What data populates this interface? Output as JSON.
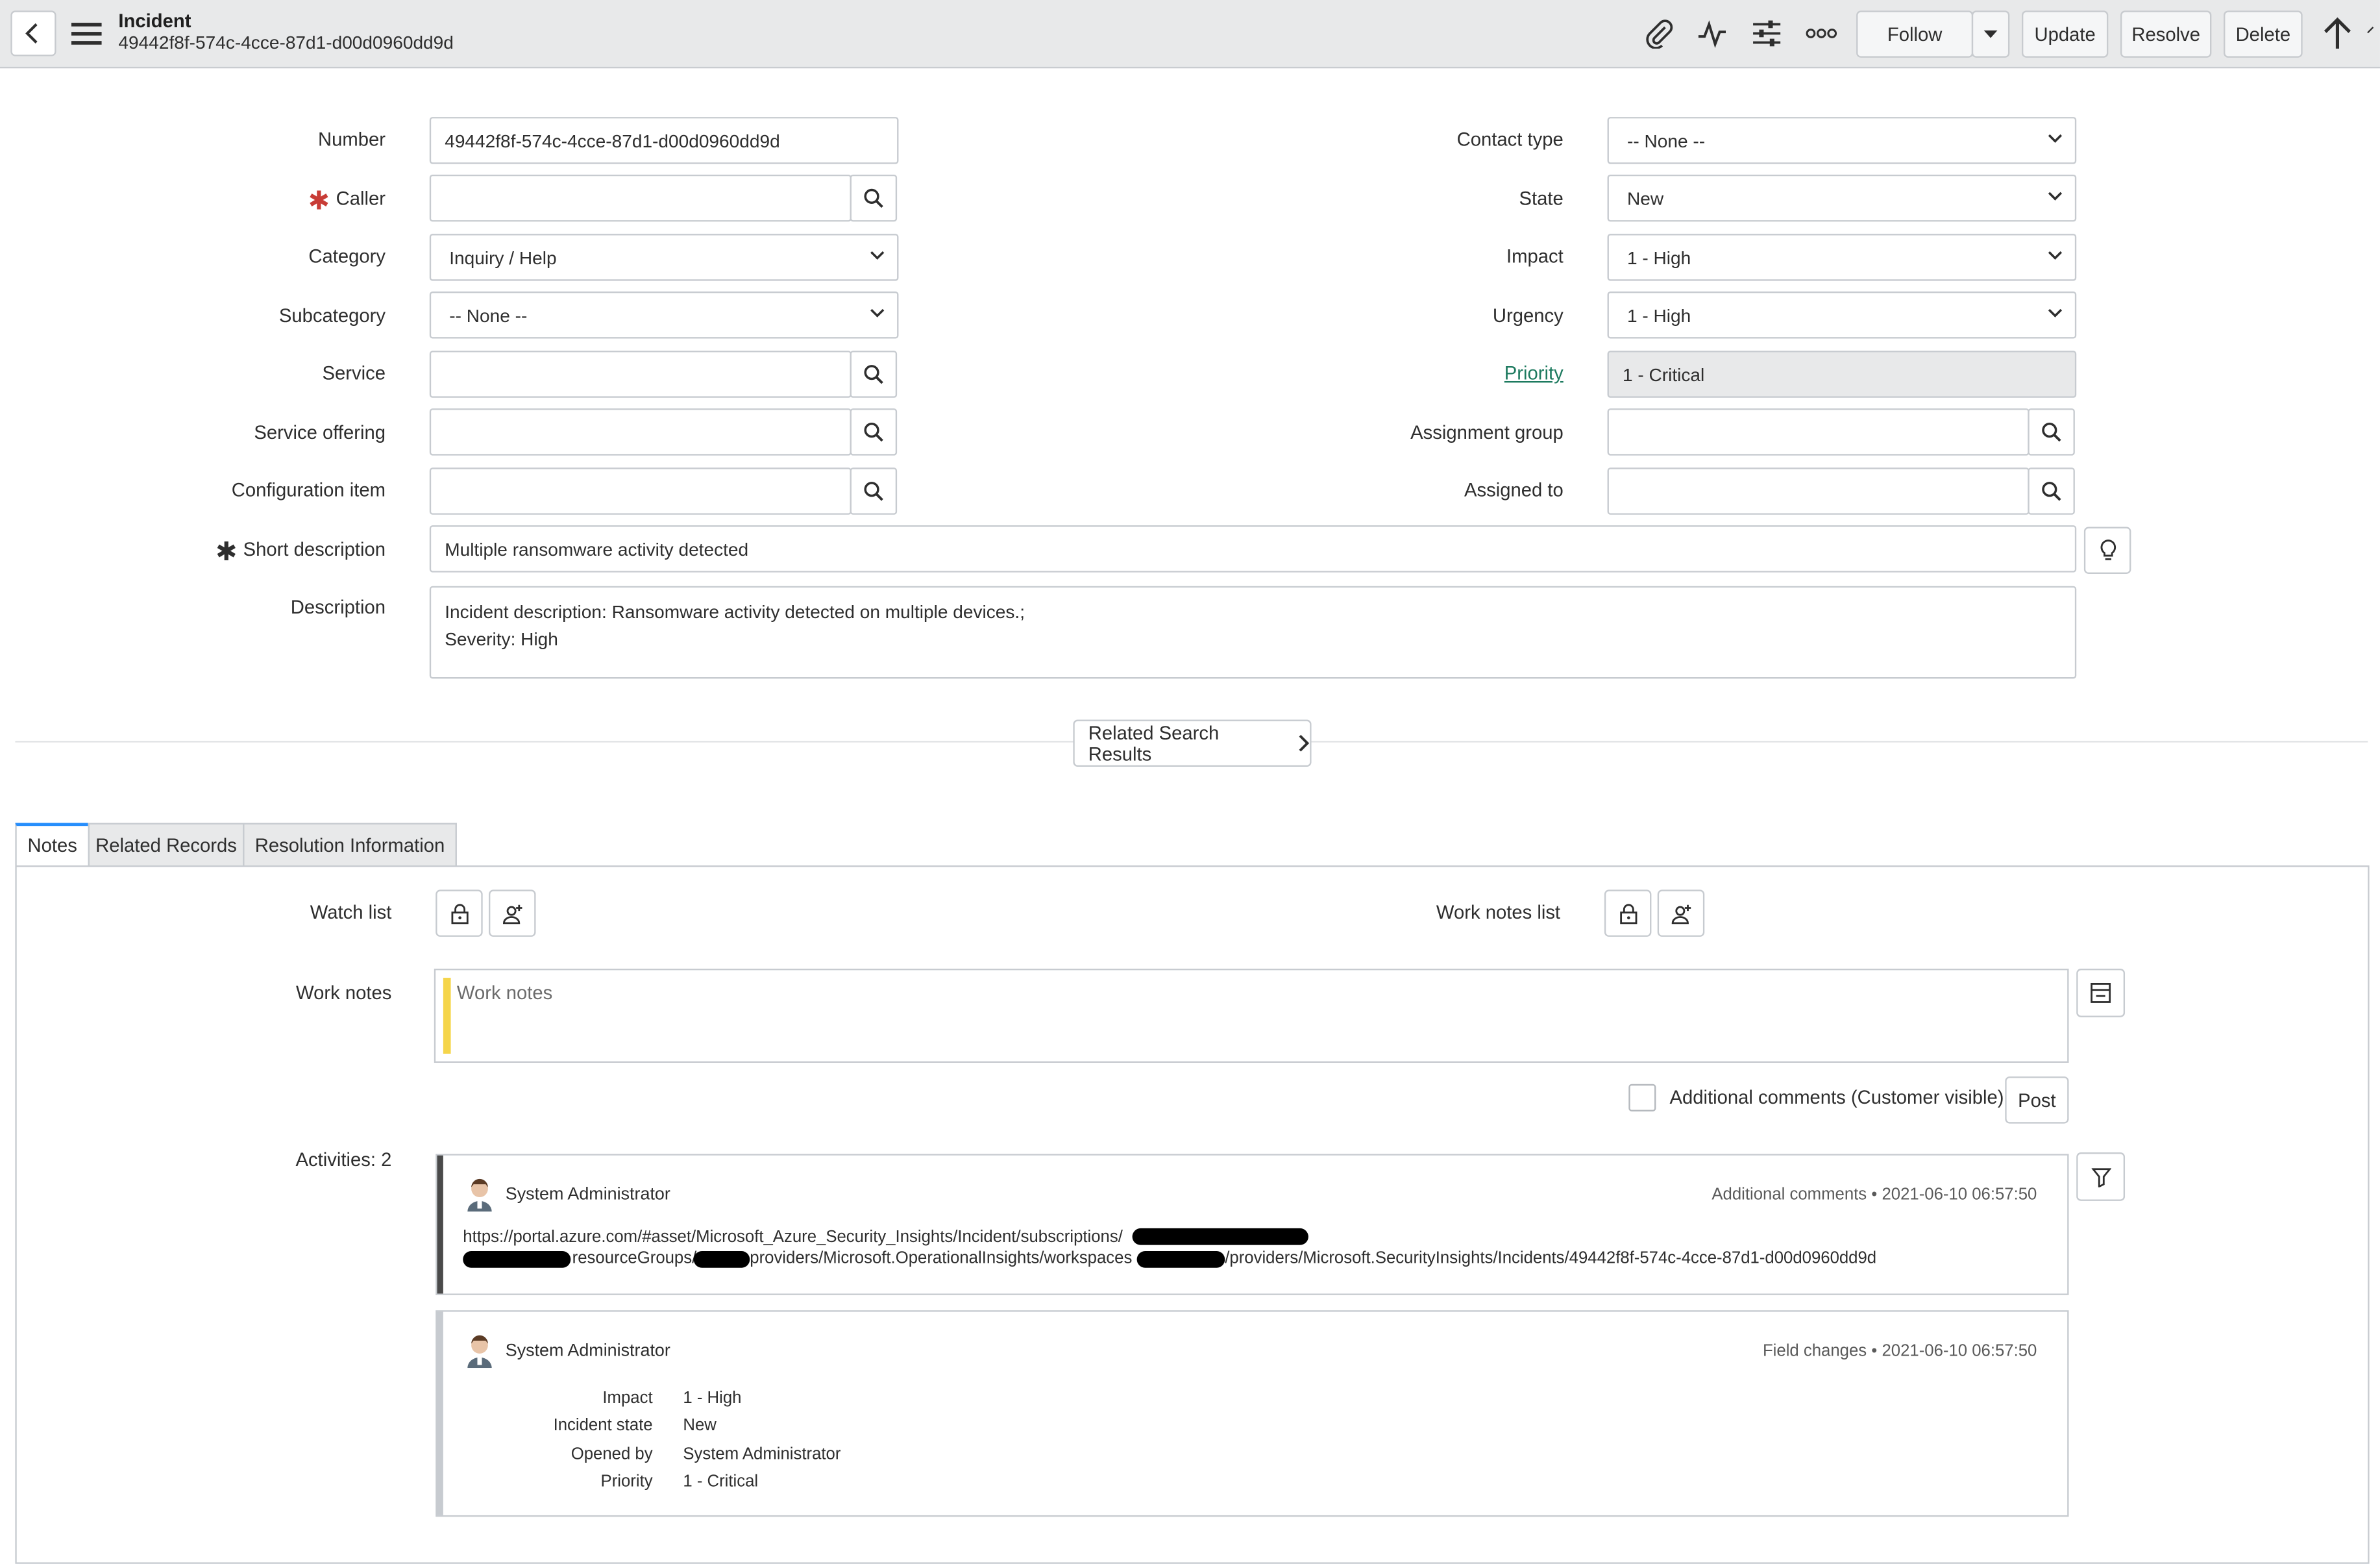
{
  "header": {
    "record_type": "Incident",
    "record_number": "49442f8f-574c-4cce-87d1-d00d0960dd9d",
    "follow_label": "Follow",
    "update_label": "Update",
    "resolve_label": "Resolve",
    "delete_label": "Delete"
  },
  "form": {
    "left": {
      "number": {
        "label": "Number",
        "value": "49442f8f-574c-4cce-87d1-d00d0960dd9d"
      },
      "caller": {
        "label": "Caller",
        "value": ""
      },
      "category": {
        "label": "Category",
        "value": "Inquiry / Help"
      },
      "subcategory": {
        "label": "Subcategory",
        "value": "-- None --"
      },
      "service": {
        "label": "Service",
        "value": ""
      },
      "service_offering": {
        "label": "Service offering",
        "value": ""
      },
      "configuration_item": {
        "label": "Configuration item",
        "value": ""
      }
    },
    "right": {
      "contact_type": {
        "label": "Contact type",
        "value": "-- None --"
      },
      "state": {
        "label": "State",
        "value": "New"
      },
      "impact": {
        "label": "Impact",
        "value": "1 - High"
      },
      "urgency": {
        "label": "Urgency",
        "value": "1 - High"
      },
      "priority": {
        "label": "Priority",
        "value": "1 - Critical"
      },
      "assignment_group": {
        "label": "Assignment group",
        "value": ""
      },
      "assigned_to": {
        "label": "Assigned to",
        "value": ""
      }
    },
    "short_description": {
      "label": "Short description",
      "value": "Multiple ransomware activity detected"
    },
    "description": {
      "label": "Description",
      "line1": "Incident description: Ransomware activity detected on multiple devices.;",
      "line2": "Severity: High"
    },
    "related_search_label": "Related Search Results"
  },
  "tabs": [
    {
      "label": "Notes"
    },
    {
      "label": "Related Records"
    },
    {
      "label": "Resolution Information"
    }
  ],
  "notes": {
    "watch_list_label": "Watch list",
    "work_notes_list_label": "Work notes list",
    "work_notes_label": "Work notes",
    "work_notes_placeholder": "Work notes",
    "additional_comments_label": "Additional comments (Customer visible)",
    "post_label": "Post",
    "activities_label": "Activities: 2"
  },
  "activities": [
    {
      "author": "System Administrator",
      "type": "Additional comments",
      "timestamp": "2021-06-10 06:57:50",
      "url_line1": "https://portal.azure.com/#asset/Microsoft_Azure_Security_Insights/Incident/subscriptions/",
      "url_part_resource": "resourceGroups/",
      "url_part_providers": "providers/Microsoft.OperationalInsights/workspaces",
      "url_part_tail": "/providers/Microsoft.SecurityInsights/Incidents/49442f8f-574c-4cce-87d1-d00d0960dd9d",
      "bar_color": "#4a4a4a"
    },
    {
      "author": "System Administrator",
      "type": "Field changes",
      "timestamp": "2021-06-10 06:57:50",
      "bar_color": "#c7cbd0",
      "changes": [
        {
          "field": "Impact",
          "value": "1 - High"
        },
        {
          "field": "Incident state",
          "value": "New"
        },
        {
          "field": "Opened by",
          "value": "System Administrator"
        },
        {
          "field": "Priority",
          "value": "1 - Critical"
        }
      ]
    }
  ],
  "colors": {
    "required_red": "#c83c36",
    "required_dark": "#2e2e2e",
    "priority_link": "#1d7a5f",
    "work_notes_bar": "#f5d54a",
    "active_tab": "#278efc"
  }
}
